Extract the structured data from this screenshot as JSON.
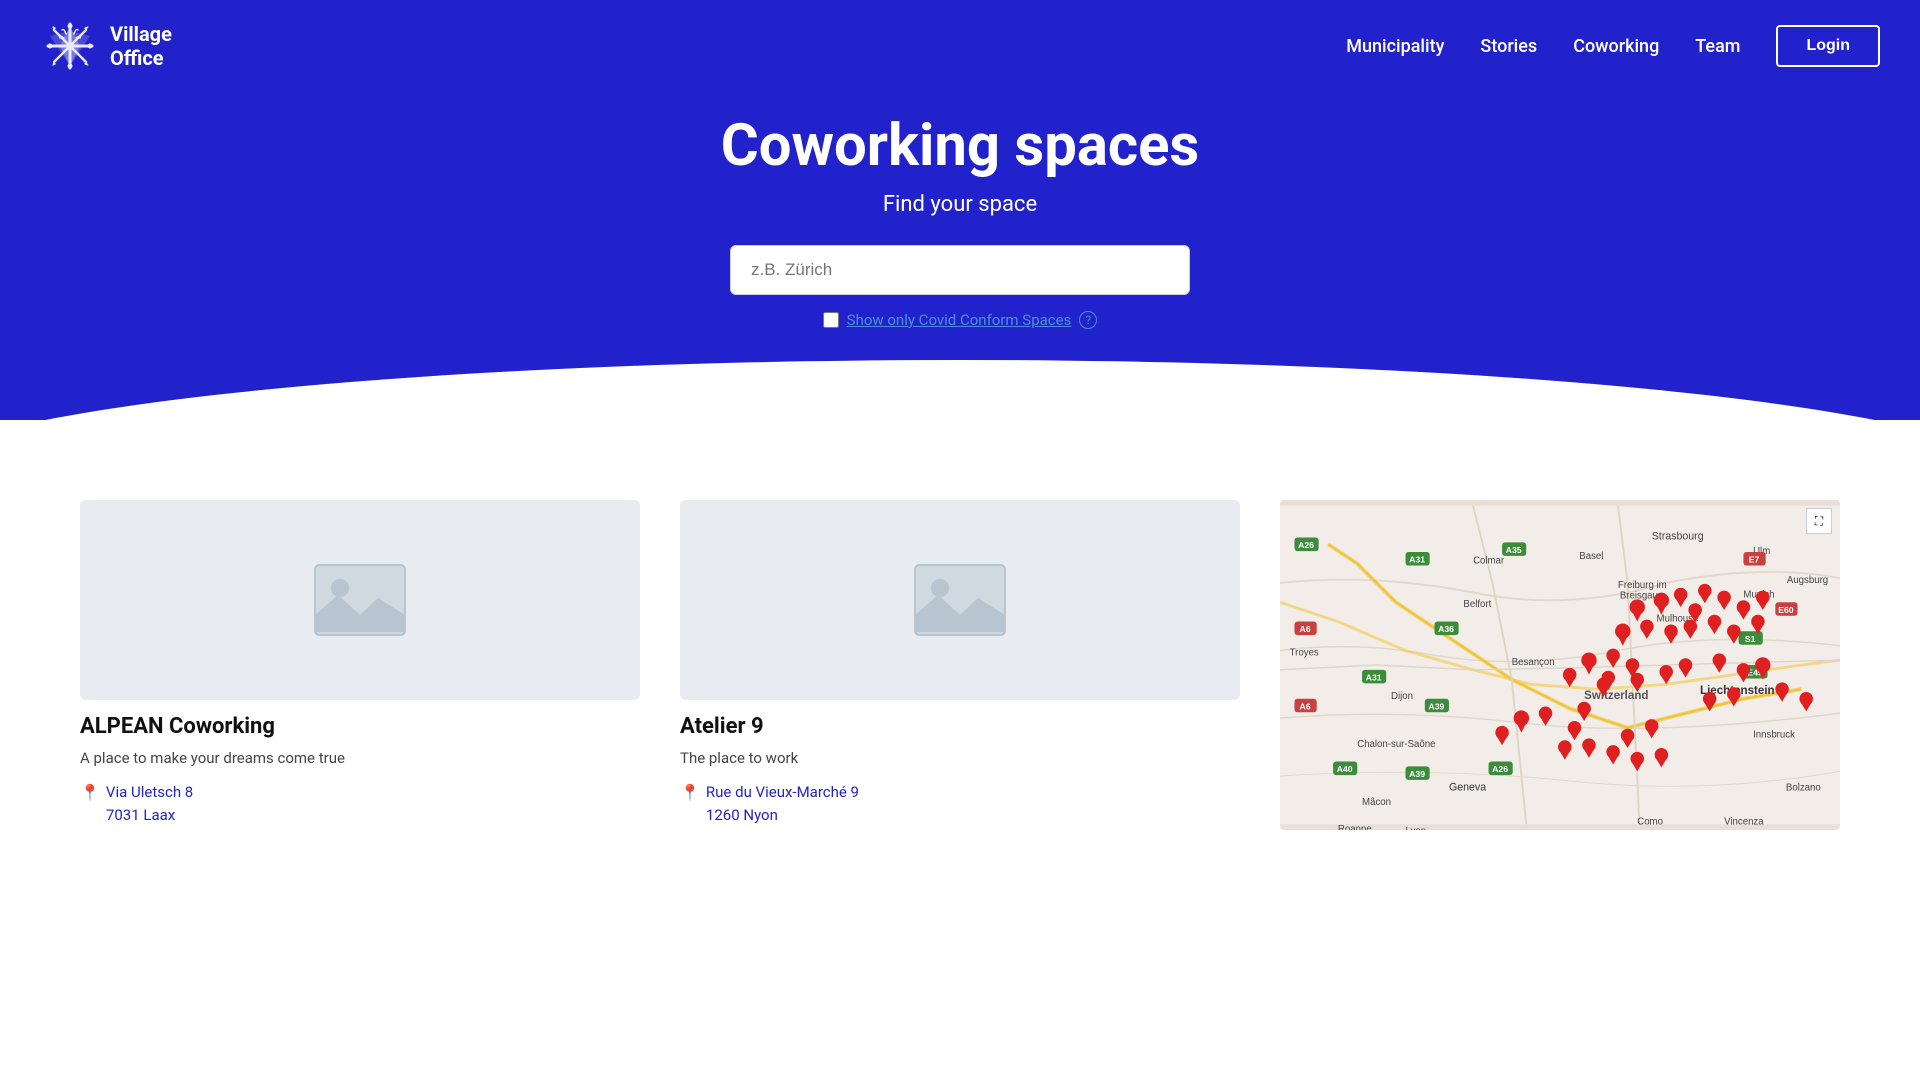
{
  "logo": {
    "text_line1": "Village",
    "text_line2": "Office",
    "alt": "Village Office logo"
  },
  "nav": {
    "items": [
      {
        "label": "Municipality",
        "id": "municipality"
      },
      {
        "label": "Stories",
        "id": "stories"
      },
      {
        "label": "Coworking",
        "id": "coworking"
      },
      {
        "label": "Team",
        "id": "team"
      }
    ],
    "login_label": "Login"
  },
  "hero": {
    "title": "Coworking spaces",
    "subtitle": "Find your space",
    "search_placeholder": "z.B. Zürich",
    "covid_label": "Show only Covid Conform Spaces",
    "covid_help": "?"
  },
  "cards": [
    {
      "title": "ALPEAN Coworking",
      "description": "A place to make your dreams come true",
      "address_line1": "Via Uletsch 8",
      "address_line2": "7031 Laax"
    },
    {
      "title": "Atelier 9",
      "description": "The place to work",
      "address_line1": "Rue du Vieux-Marché 9",
      "address_line2": "1260 Nyon"
    }
  ],
  "map": {
    "expand_icon": "⛶"
  }
}
